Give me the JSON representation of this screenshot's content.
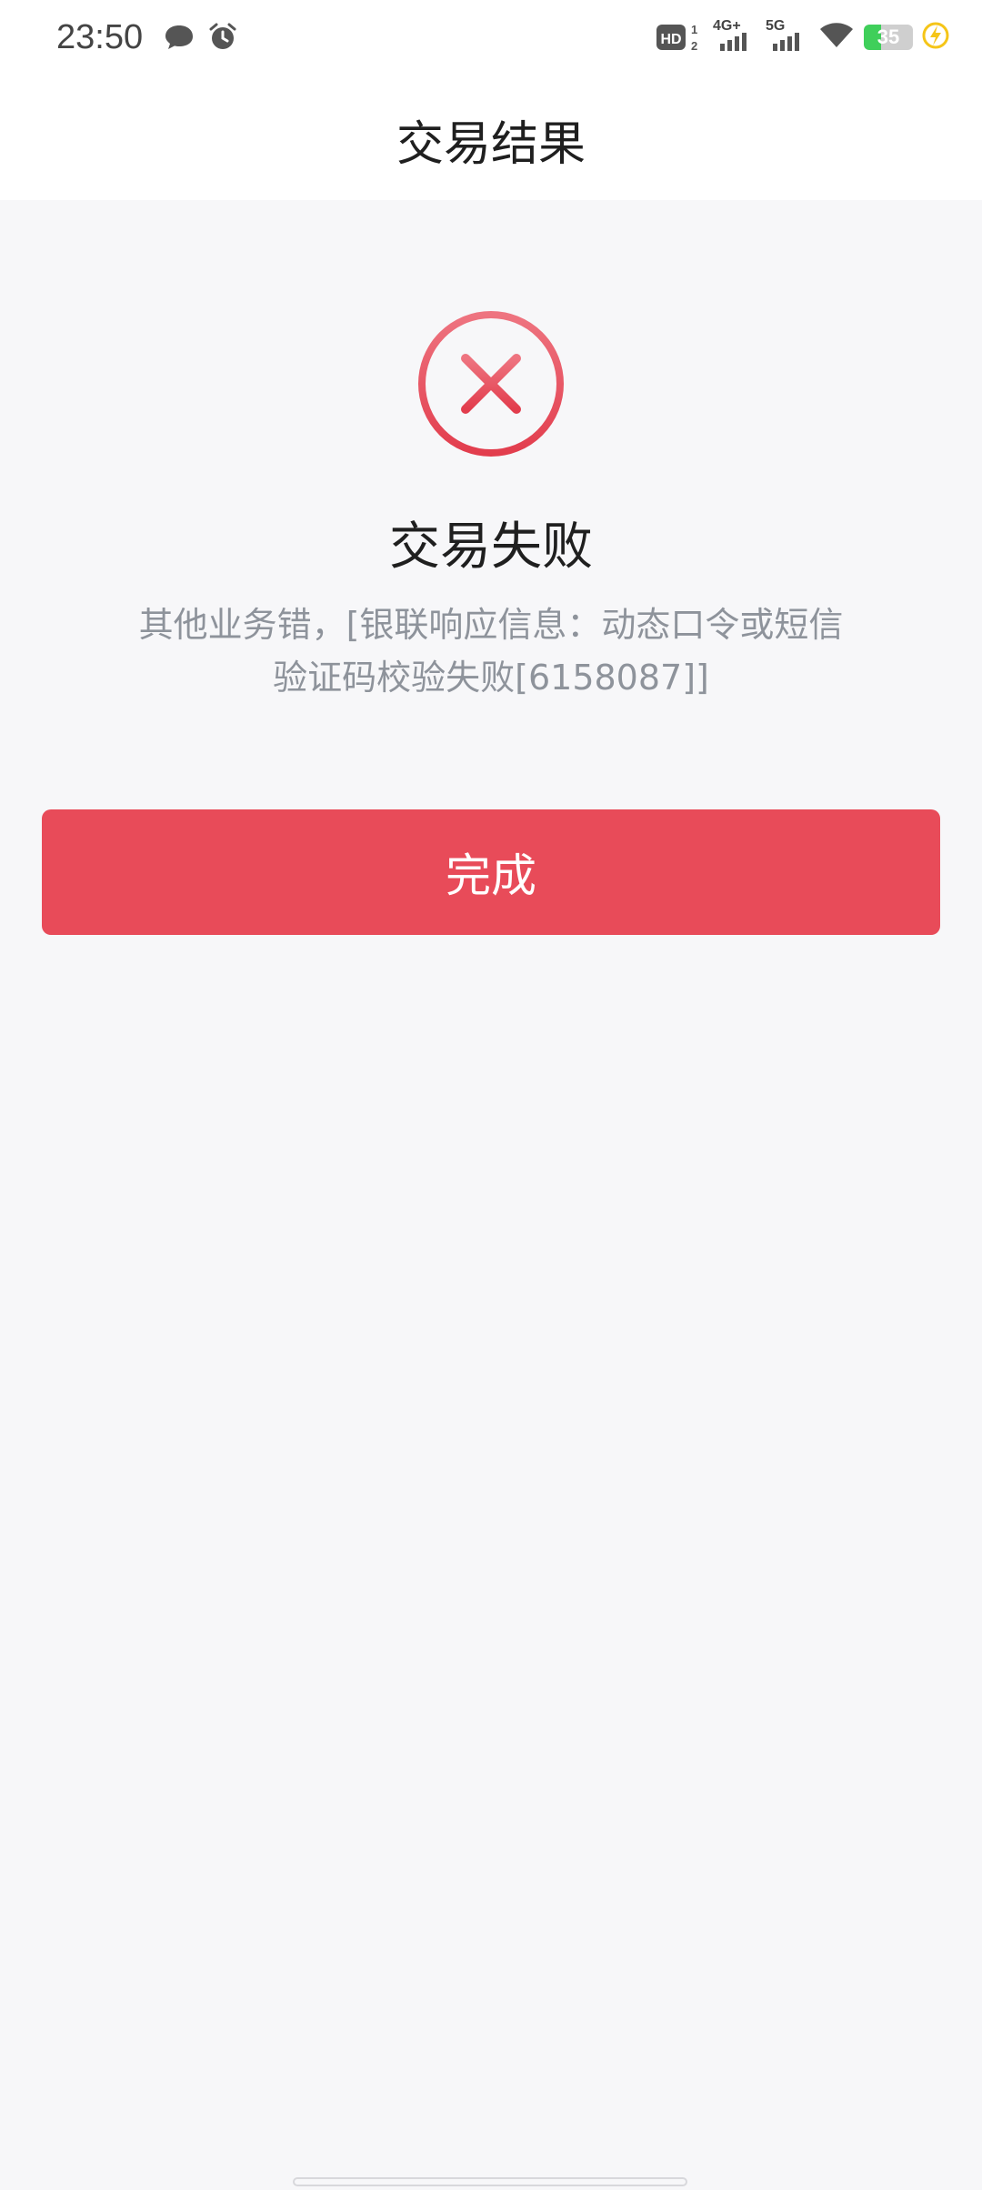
{
  "status_bar": {
    "time": "23:50",
    "left_icons": [
      "chat-bubble-icon",
      "alarm-clock-icon"
    ],
    "hd_label": "HD",
    "hd_sim_numbers": [
      "1",
      "2"
    ],
    "signal_1_label": "4G+",
    "signal_2_label": "5G",
    "battery_level": "35",
    "battery_fraction": 0.35,
    "colors": {
      "battery_fill": "#3fcf5a",
      "charging_bolt": "#f5c518"
    }
  },
  "nav": {
    "title": "交易结果"
  },
  "result": {
    "status_icon": "error-circle-x-icon",
    "title": "交易失败",
    "message": "其他业务错，[银联响应信息：动态口令或短信验证码校验失败[6158087]]",
    "colors": {
      "icon": "#e84b59"
    }
  },
  "actions": {
    "done_label": "完成",
    "colors": {
      "button_bg": "#e84b59",
      "button_text": "#ffffff"
    }
  }
}
